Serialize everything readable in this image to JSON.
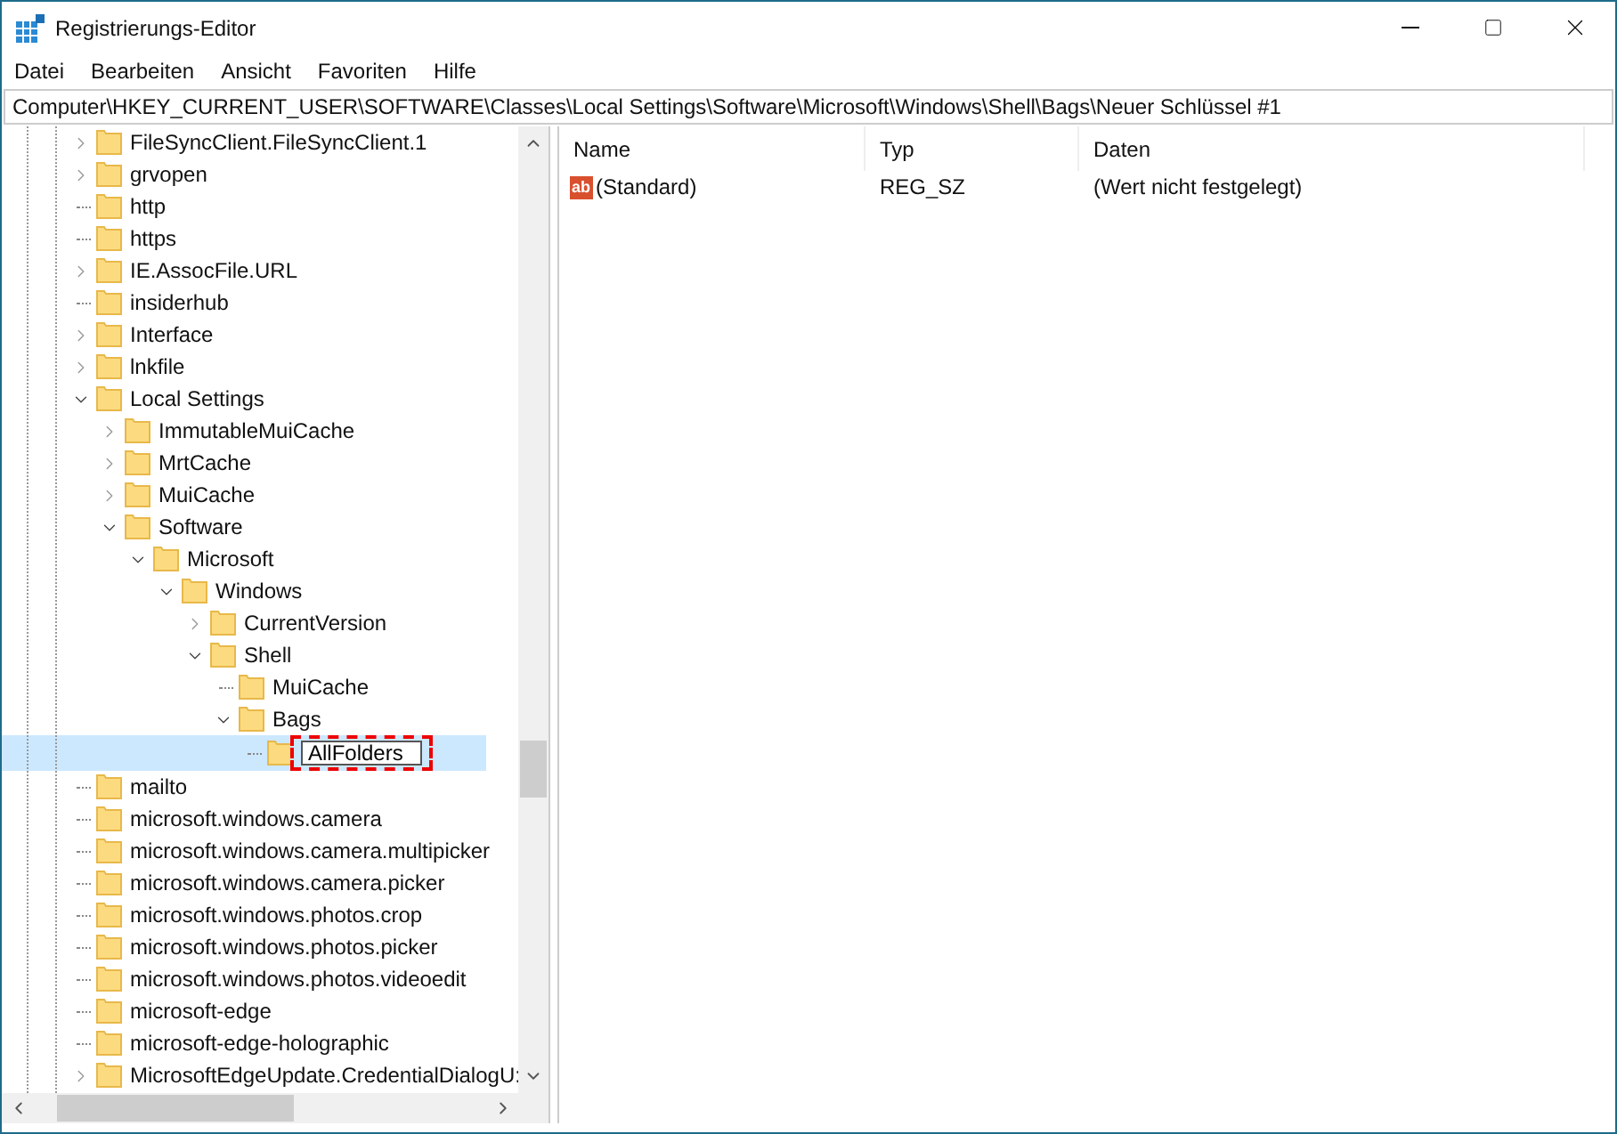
{
  "window": {
    "title": "Registrierungs-Editor"
  },
  "menu": [
    "Datei",
    "Bearbeiten",
    "Ansicht",
    "Favoriten",
    "Hilfe"
  ],
  "address": "Computer\\HKEY_CURRENT_USER\\SOFTWARE\\Classes\\Local Settings\\Software\\Microsoft\\Windows\\Shell\\Bags\\Neuer Schlüssel #1",
  "tree": [
    {
      "label": "FileSyncClient.FileSyncClient.1",
      "kind": "branch",
      "expanded": false
    },
    {
      "label": "grvopen",
      "kind": "branch",
      "expanded": false
    },
    {
      "label": "http",
      "kind": "leaf"
    },
    {
      "label": "https",
      "kind": "leaf"
    },
    {
      "label": "IE.AssocFile.URL",
      "kind": "branch",
      "expanded": false
    },
    {
      "label": "insiderhub",
      "kind": "leaf"
    },
    {
      "label": "Interface",
      "kind": "branch",
      "expanded": false
    },
    {
      "label": "lnkfile",
      "kind": "branch",
      "expanded": false
    },
    {
      "label": "Local Settings",
      "kind": "branch",
      "expanded": true,
      "children": [
        {
          "label": "ImmutableMuiCache",
          "kind": "branch",
          "expanded": false
        },
        {
          "label": "MrtCache",
          "kind": "branch",
          "expanded": false
        },
        {
          "label": "MuiCache",
          "kind": "branch",
          "expanded": false
        },
        {
          "label": "Software",
          "kind": "branch",
          "expanded": true,
          "children": [
            {
              "label": "Microsoft",
              "kind": "branch",
              "expanded": true,
              "children": [
                {
                  "label": "Windows",
                  "kind": "branch",
                  "expanded": true,
                  "children": [
                    {
                      "label": "CurrentVersion",
                      "kind": "branch",
                      "expanded": false
                    },
                    {
                      "label": "Shell",
                      "kind": "branch",
                      "expanded": true,
                      "children": [
                        {
                          "label": "MuiCache",
                          "kind": "leaf"
                        },
                        {
                          "label": "Bags",
                          "kind": "branch",
                          "expanded": true,
                          "children": [
                            {
                              "label": "AllFolders",
                              "kind": "editing"
                            }
                          ]
                        }
                      ]
                    }
                  ]
                }
              ]
            }
          ]
        }
      ]
    },
    {
      "label": "mailto",
      "kind": "leaf"
    },
    {
      "label": "microsoft.windows.camera",
      "kind": "leaf"
    },
    {
      "label": "microsoft.windows.camera.multipicker",
      "kind": "leaf"
    },
    {
      "label": "microsoft.windows.camera.picker",
      "kind": "leaf"
    },
    {
      "label": "microsoft.windows.photos.crop",
      "kind": "leaf"
    },
    {
      "label": "microsoft.windows.photos.picker",
      "kind": "leaf"
    },
    {
      "label": "microsoft.windows.photos.videoedit",
      "kind": "leaf"
    },
    {
      "label": "microsoft-edge",
      "kind": "leaf"
    },
    {
      "label": "microsoft-edge-holographic",
      "kind": "leaf"
    },
    {
      "label": "MicrosoftEdgeUpdate.CredentialDialogU:",
      "kind": "branch",
      "expanded": false
    }
  ],
  "table": {
    "columns": [
      "Name",
      "Typ",
      "Daten"
    ],
    "rows": [
      {
        "icon_text": "ab",
        "name": "(Standard)",
        "type": "REG_SZ",
        "data": "(Wert nicht festgelegt)"
      }
    ]
  }
}
